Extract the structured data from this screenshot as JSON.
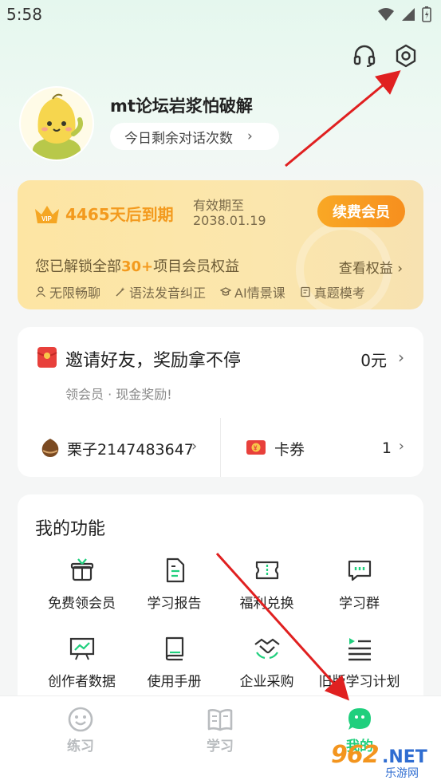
{
  "status_bar": {
    "time": "5:58"
  },
  "profile": {
    "username": "mt论坛岩浆怕破解",
    "chat_remaining_label": "今日剩余对话次数"
  },
  "vip": {
    "expire_text": "4465天后到期",
    "validity_label": "有效期至",
    "validity_date": "2038.01.19",
    "renew_label": "续费会员",
    "unlock_prefix": "您已解锁全部",
    "unlock_highlight": "30+",
    "unlock_suffix": "项目会员权益",
    "view_rights_label": "查看权益",
    "features": [
      "无限畅聊",
      "语法发音纠正",
      "AI情景课",
      "真题模考"
    ],
    "accent_color": "#f39a1e"
  },
  "invite": {
    "title": "邀请好友，奖励拿不停",
    "amount": "0元",
    "subtitle": "领会员 · 现金奖励!",
    "chestnut_label": "栗子",
    "chestnut_value": "2147483647",
    "coupon_label": "卡券",
    "coupon_count": "1"
  },
  "functions": {
    "title": "我的功能",
    "items": [
      {
        "label": "免费领会员",
        "icon": "gift-icon"
      },
      {
        "label": "学习报告",
        "icon": "report-icon"
      },
      {
        "label": "福利兑换",
        "icon": "ticket-icon"
      },
      {
        "label": "学习群",
        "icon": "chat-group-icon"
      },
      {
        "label": "创作者数据",
        "icon": "chart-board-icon"
      },
      {
        "label": "使用手册",
        "icon": "book-icon"
      },
      {
        "label": "企业采购",
        "icon": "handshake-icon"
      },
      {
        "label": "旧版学习计划",
        "icon": "list-play-icon"
      }
    ]
  },
  "bottom_nav": {
    "items": [
      {
        "label": "练习",
        "icon": "smile-face-icon"
      },
      {
        "label": "学习",
        "icon": "open-book-icon"
      },
      {
        "label": "我的",
        "icon": "chat-bubble-icon",
        "active": true
      }
    ],
    "active_color": "#1fcf7d"
  },
  "watermark": {
    "number": "962",
    "domain": ".NET",
    "sub": "乐游网"
  }
}
